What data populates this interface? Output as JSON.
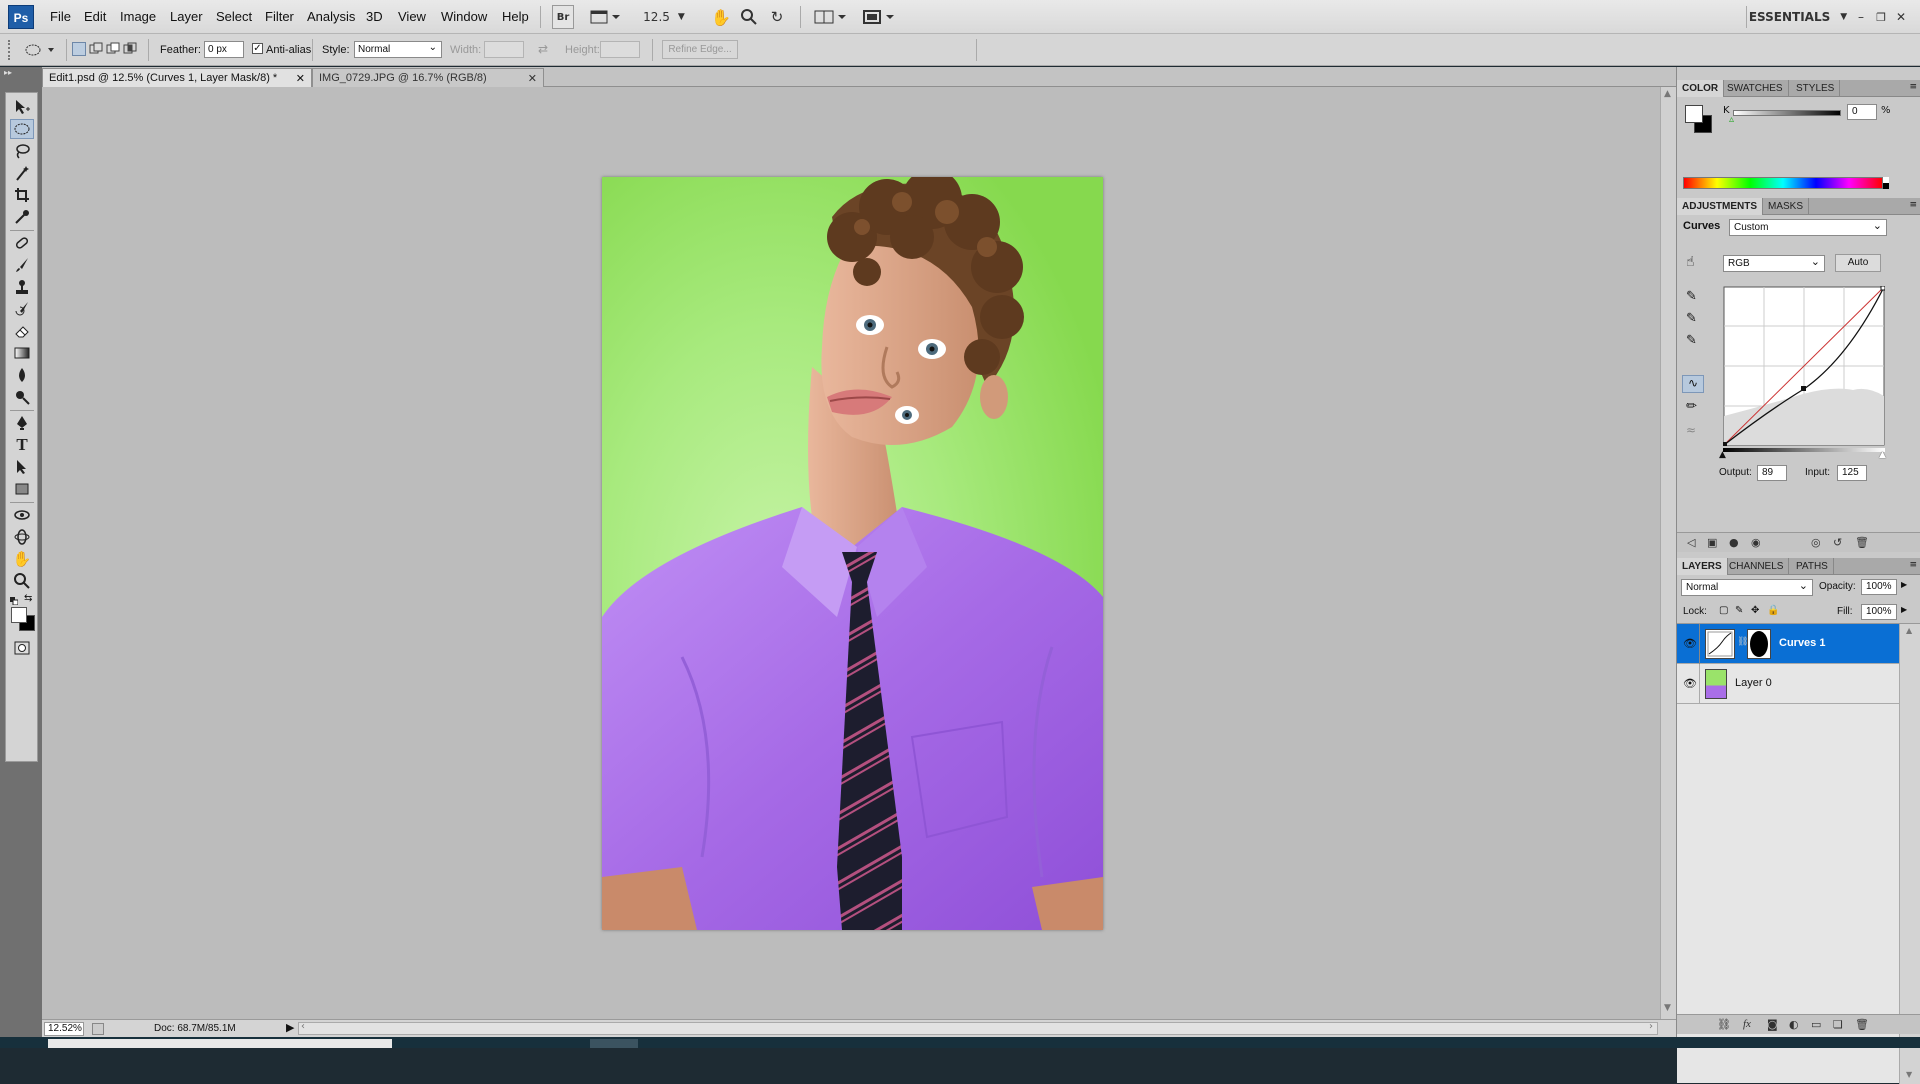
{
  "menubar": {
    "logo": "Ps",
    "items": [
      "File",
      "Edit",
      "Image",
      "Layer",
      "Select",
      "Filter",
      "Analysis",
      "3D",
      "View",
      "Window",
      "Help"
    ],
    "bridge_label": "Br",
    "zoom_value": "12.5",
    "workspace": "ESSENTIALS"
  },
  "options": {
    "feather_label": "Feather:",
    "feather_value": "0 px",
    "antialias_label": "Anti-alias",
    "style_label": "Style:",
    "style_value": "Normal",
    "width_label": "Width:",
    "height_label": "Height:",
    "refine_edge_label": "Refine Edge..."
  },
  "tabs": [
    {
      "label": "Edit1.psd @ 12.5% (Curves 1, Layer Mask/8) *",
      "active": true
    },
    {
      "label": "IMG_0729.JPG @ 16.7% (RGB/8)",
      "active": false
    }
  ],
  "status": {
    "zoom": "12.52%",
    "doc": "Doc: 68.7M/85.1M"
  },
  "color_panel": {
    "tabs": [
      "COLOR",
      "SWATCHES",
      "STYLES"
    ],
    "channel_label": "K",
    "k_value": "0",
    "percent": "%"
  },
  "adjustments_panel": {
    "tabs": [
      "ADJUSTMENTS",
      "MASKS"
    ],
    "title": "Curves",
    "preset": "Custom",
    "channel": "RGB",
    "auto_label": "Auto",
    "output_label": "Output:",
    "output_value": "89",
    "input_label": "Input:",
    "input_value": "125"
  },
  "layers_panel": {
    "tabs": [
      "LAYERS",
      "CHANNELS",
      "PATHS"
    ],
    "blend_mode": "Normal",
    "opacity_label": "Opacity:",
    "opacity_value": "100%",
    "lock_label": "Lock:",
    "fill_label": "Fill:",
    "fill_value": "100%",
    "layers": [
      {
        "name": "Curves 1",
        "selected": true
      },
      {
        "name": "Layer 0",
        "selected": false
      }
    ]
  },
  "colors": {
    "selection": "#0a6fd4",
    "shirt": "#a96ee8",
    "background_green": "#9ae36a"
  }
}
